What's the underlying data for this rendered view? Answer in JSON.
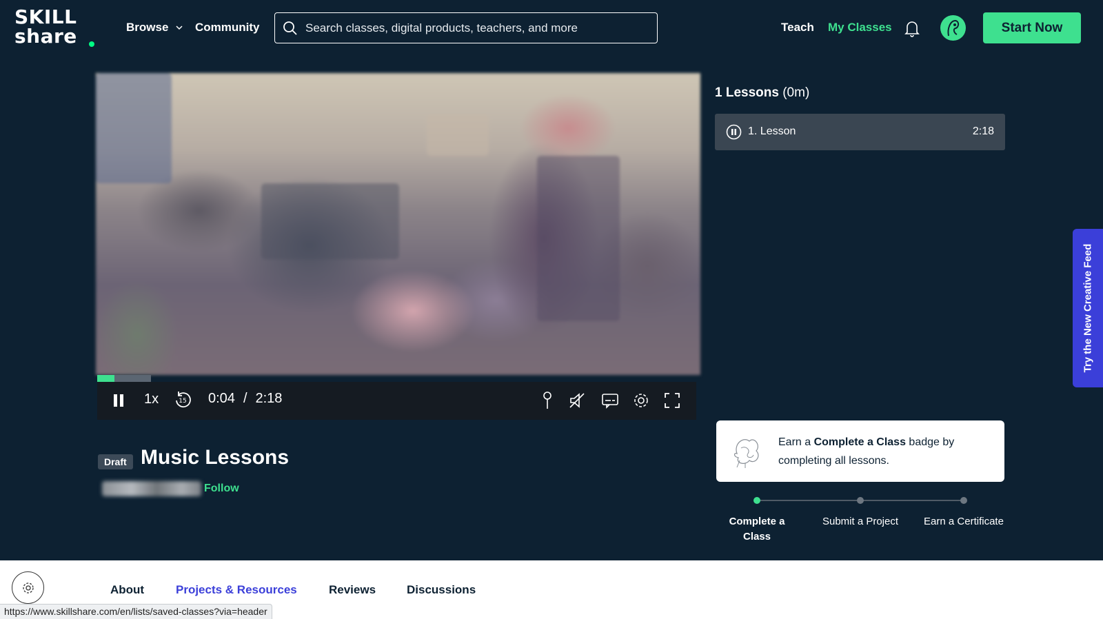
{
  "header": {
    "logo_line1": "SKILL",
    "logo_line2": "share",
    "browse_label": "Browse",
    "community_label": "Community",
    "search_placeholder": "Search classes, digital products, teachers, and more",
    "teach_label": "Teach",
    "my_classes_label": "My Classes",
    "start_now_label": "Start Now"
  },
  "player": {
    "speed": "1x",
    "current_time": "0:04",
    "separator": "/",
    "duration": "2:18",
    "progress_fraction": 0.029,
    "buffered_fraction": 0.09
  },
  "class": {
    "status_badge": "Draft",
    "title": "Music Lessons",
    "follow_label": "Follow"
  },
  "lessons": {
    "count_label": "1 Lessons",
    "total_label": "(0m)",
    "items": [
      {
        "label": "1.  Lesson",
        "duration": "2:18"
      }
    ]
  },
  "badge": {
    "text_prefix": "Earn a ",
    "text_bold": "Complete a Class",
    "text_suffix": " badge by completing all lessons."
  },
  "steps": [
    {
      "label": "Complete a Class",
      "active": true
    },
    {
      "label": "Submit a Project",
      "active": false
    },
    {
      "label": "Earn a Certificate",
      "active": false
    }
  ],
  "feed_tab_label": "Try the New Creative Feed",
  "tabs": [
    "About",
    "Projects & Resources",
    "Reviews",
    "Discussions"
  ],
  "status_url": "https://www.skillshare.com/en/lists/saved-classes?via=header",
  "colors": {
    "background": "#0d2132",
    "accent_green": "#3ee08f",
    "accent_blue": "#3b3fd9"
  }
}
